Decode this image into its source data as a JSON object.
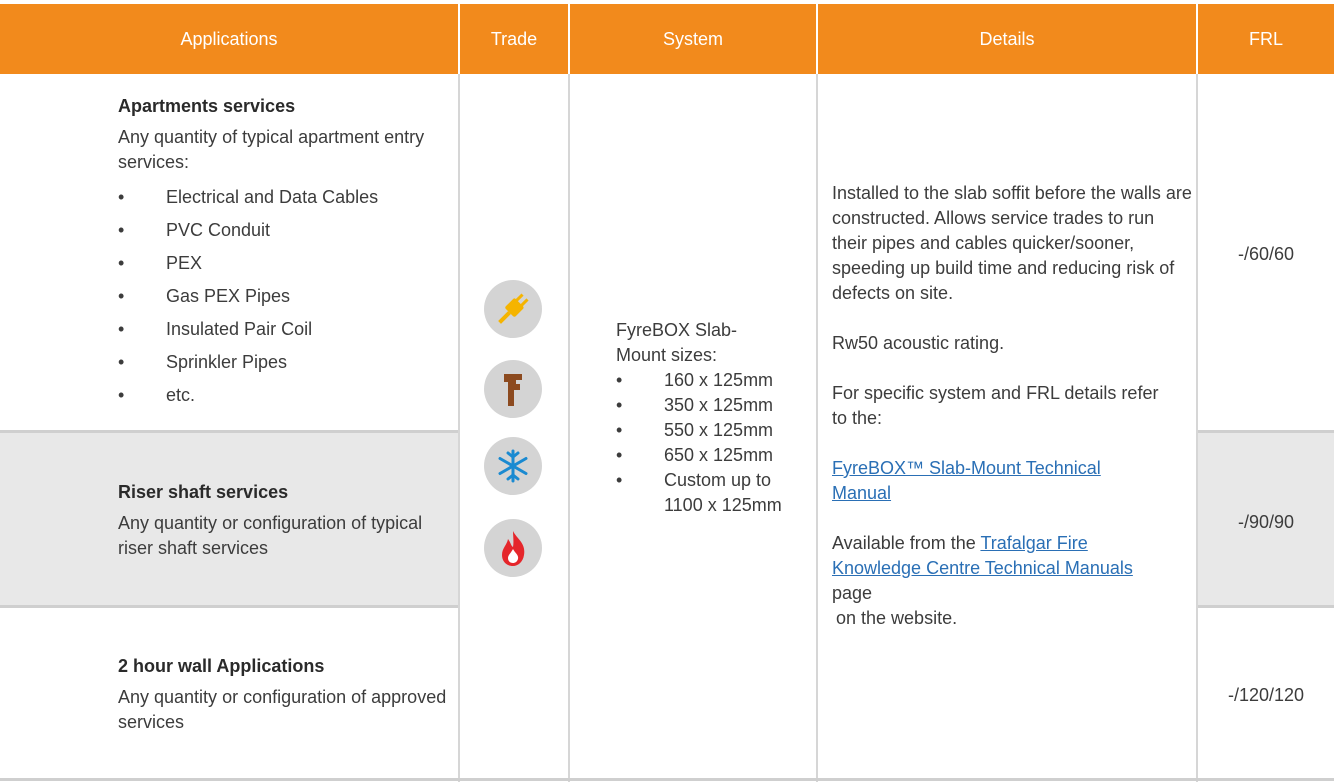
{
  "header": {
    "applications": "Applications",
    "trade": "Trade",
    "system": "System",
    "details": "Details",
    "frl": "FRL"
  },
  "rows": [
    {
      "title": "Apartments services",
      "description": "Any quantity of typical apartment entry services:",
      "items": [
        "Electrical and Data Cables",
        "PVC Conduit",
        "PEX",
        "Gas PEX Pipes",
        "Insulated Pair Coil",
        "Sprinkler Pipes",
        "etc."
      ],
      "frl": "-/60/60"
    },
    {
      "title": "Riser shaft services",
      "description": "Any quantity or configuration of typical riser shaft services",
      "frl": "-/90/90"
    },
    {
      "title": "2 hour wall Applications",
      "description": "Any quantity or configuration of approved services",
      "frl": "-/120/120"
    }
  ],
  "trade_icons": [
    "electrical-plug-icon",
    "plumbing-wrench-icon",
    "hvac-snowflake-icon",
    "fire-flame-icon"
  ],
  "system": {
    "intro": "FyreBOX Slab-Mount sizes:",
    "sizes": [
      "160 x 125mm",
      "350 x 125mm",
      "550 x 125mm",
      "650 x 125mm",
      "Custom up to 1100 x 125mm"
    ]
  },
  "details": {
    "para1": "Installed to the slab soffit before the walls are constructed. Allows service trades to run their pipes and cables quicker/sooner, speeding up build time and reducing risk of defects on site.",
    "para2": "Rw50 acoustic rating.",
    "para3": "For specific system and FRL details refer to the:",
    "manual_link": "FyreBOX™ Slab-Mount Technical Manual",
    "available_prefix": "Available from the",
    "knowledge_link": "Trafalgar Fire Knowledge Centre Technical Manuals",
    "page_word": "page",
    "website_suffix": "on the website."
  },
  "colors": {
    "header_bg": "#f28a1c",
    "header_text": "#ffffff",
    "alt_row_bg": "#e8e8e8",
    "link": "#2a6fb5"
  }
}
